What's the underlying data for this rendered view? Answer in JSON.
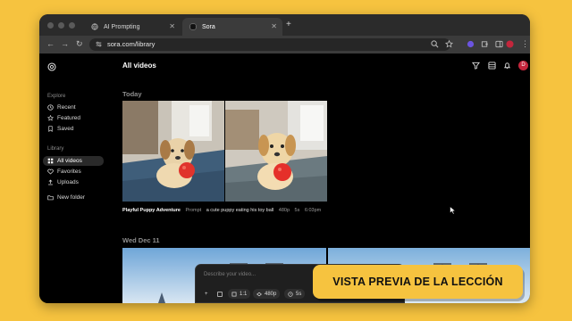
{
  "tabs": [
    {
      "title": "AI Prompting"
    },
    {
      "title": "Sora"
    }
  ],
  "address_bar": {
    "url": "sora.com/library"
  },
  "sidebar": {
    "explore_heading": "Explore",
    "explore_items": [
      {
        "label": "Recent",
        "icon": "clock-icon"
      },
      {
        "label": "Featured",
        "icon": "star-icon"
      },
      {
        "label": "Saved",
        "icon": "bookmark-icon"
      }
    ],
    "library_heading": "Library",
    "library_items": [
      {
        "label": "All videos",
        "icon": "grid-icon",
        "active": true
      },
      {
        "label": "Favorites",
        "icon": "heart-icon"
      },
      {
        "label": "Uploads",
        "icon": "upload-icon"
      }
    ],
    "new_folder": "New folder"
  },
  "main": {
    "title": "All videos",
    "section_today": "Today",
    "section_date": "Wed Dec 11",
    "video": {
      "title": "Playful Puppy Adventure",
      "prompt_label": "Prompt",
      "prompt": "a cute puppy eating his toy ball",
      "resolution": "480p",
      "duration": "5s",
      "time": "6:03pm"
    }
  },
  "prompt_bar": {
    "placeholder": "Describe your video...",
    "aspect": "1:1",
    "resolution": "480p",
    "duration": "5s"
  },
  "user": {
    "avatar_initial": "D"
  },
  "overlay": {
    "text": "VISTA PREVIA DE LA LECCIÓN"
  },
  "colors": {
    "background": "#f6c33f",
    "avatar": "#c4263c",
    "badge": "#f6c33f"
  }
}
